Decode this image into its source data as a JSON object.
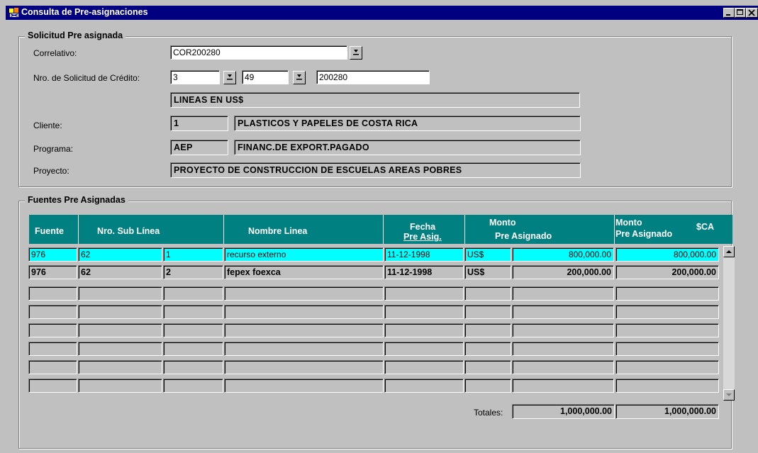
{
  "window": {
    "title": "Consulta de Pre-asignaciones",
    "buttons": [
      "minimize",
      "maximize",
      "close"
    ]
  },
  "solicitud": {
    "legend": "Solicitud Pre asignada",
    "correlativo_label": "Correlativo:",
    "correlativo_value": "COR200280",
    "nro_label": "Nro. de Solicitud de Crédito:",
    "nro_1": "3",
    "nro_2": "49",
    "nro_3": "200280",
    "linea_desc": "LINEAS EN US$",
    "cliente_label": "Cliente:",
    "cliente_code": "1",
    "cliente_name": "PLASTICOS Y PAPELES DE COSTA RICA",
    "programa_label": "Programa:",
    "programa_code": "AEP",
    "programa_name": "FINANC.DE EXPORT.PAGADO",
    "proyecto_label": "Proyecto:",
    "proyecto_name": "PROYECTO DE CONSTRUCCION DE ESCUELAS AREAS POBRES"
  },
  "fuentes": {
    "legend": "Fuentes Pre Asignadas",
    "headers": {
      "fuente": "Fuente",
      "sublinea": "Nro. Sub Línea",
      "nombre": "Nombre Linea",
      "fecha_1": "Fecha",
      "fecha_2": "Pre Asig.",
      "monto_1": "Monto",
      "monto_2": "Pre Asignado",
      "montoca_1": "Monto",
      "montoca_2": "Pre Asignado",
      "montoca_3": "$CA"
    },
    "rows": [
      {
        "fuente": "976",
        "linea": "62",
        "sub": "1",
        "nombre": "recurso externo",
        "fecha": "11-12-1998",
        "moneda": "US$",
        "monto": "800,000.00",
        "monto_ca": "800,000.00"
      },
      {
        "fuente": "976",
        "linea": "62",
        "sub": "2",
        "nombre": "fepex foexca",
        "fecha": "11-12-1998",
        "moneda": "US$",
        "monto": "200,000.00",
        "monto_ca": "200,000.00"
      }
    ],
    "totales_label": "Totales:",
    "total_monto": "1,000,000.00",
    "total_monto_ca": "1,000,000.00"
  },
  "icons": {
    "app": "app-icon",
    "lov": "down-arrow-icon"
  }
}
